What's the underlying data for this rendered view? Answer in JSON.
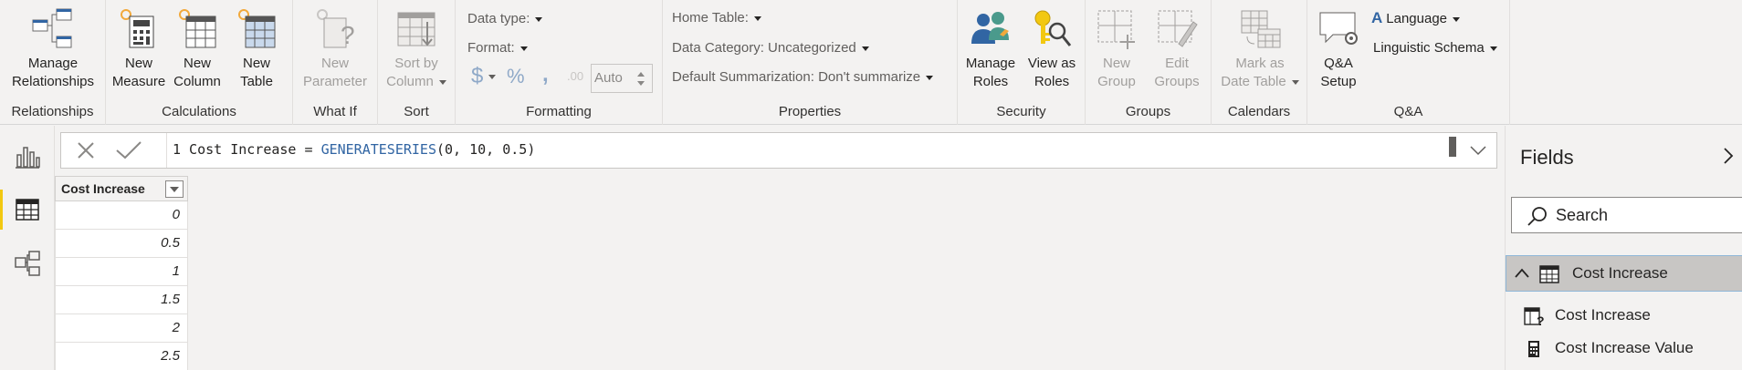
{
  "ribbon": {
    "relationships": {
      "manage_label": "Manage\nRelationships",
      "group_label": "Relationships"
    },
    "calculations": {
      "new_measure": "New\nMeasure",
      "new_column": "New\nColumn",
      "new_table": "New\nTable",
      "group_label": "Calculations"
    },
    "whatif": {
      "new_parameter": "New\nParameter",
      "group_label": "What If"
    },
    "sort": {
      "sort_by_column": "Sort by\nColumn",
      "group_label": "Sort"
    },
    "formatting": {
      "data_type": "Data type:",
      "format": "Format:",
      "currency_symbol": "$",
      "percent_symbol": "%",
      "comma_symbol": ",",
      "auto_value": "Auto",
      "group_label": "Formatting"
    },
    "properties": {
      "home_table": "Home Table:",
      "data_category": "Data Category: Uncategorized",
      "default_summarization": "Default Summarization: Don't summarize",
      "group_label": "Properties"
    },
    "security": {
      "manage_roles": "Manage\nRoles",
      "view_as_roles": "View as\nRoles",
      "group_label": "Security"
    },
    "groups": {
      "new_group": "New\nGroup",
      "edit_groups": "Edit\nGroups",
      "group_label": "Groups"
    },
    "calendars": {
      "mark_as_date_table": "Mark as\nDate Table",
      "group_label": "Calendars"
    },
    "qa": {
      "qa_setup": "Q&A\nSetup",
      "language": "Language",
      "linguistic_schema": "Linguistic Schema",
      "group_label": "Q&A"
    }
  },
  "formula_bar": {
    "line_number": "1",
    "text_before": " Cost Increase = ",
    "function_name": "GENERATESERIES",
    "text_after": "(0, 10, 0.5)"
  },
  "table": {
    "column_header": "Cost Increase",
    "rows": [
      "0",
      "0.5",
      "1",
      "1.5",
      "2",
      "2.5"
    ]
  },
  "fields_pane": {
    "title": "Fields",
    "search_placeholder": "Search",
    "table_name": "Cost Increase",
    "fields": [
      "Cost Increase",
      "Cost Increase Value"
    ]
  },
  "colors": {
    "accent_yellow": "#f2c811",
    "function_blue": "#3165a3",
    "ribbon_bg": "#f3f2f1"
  }
}
